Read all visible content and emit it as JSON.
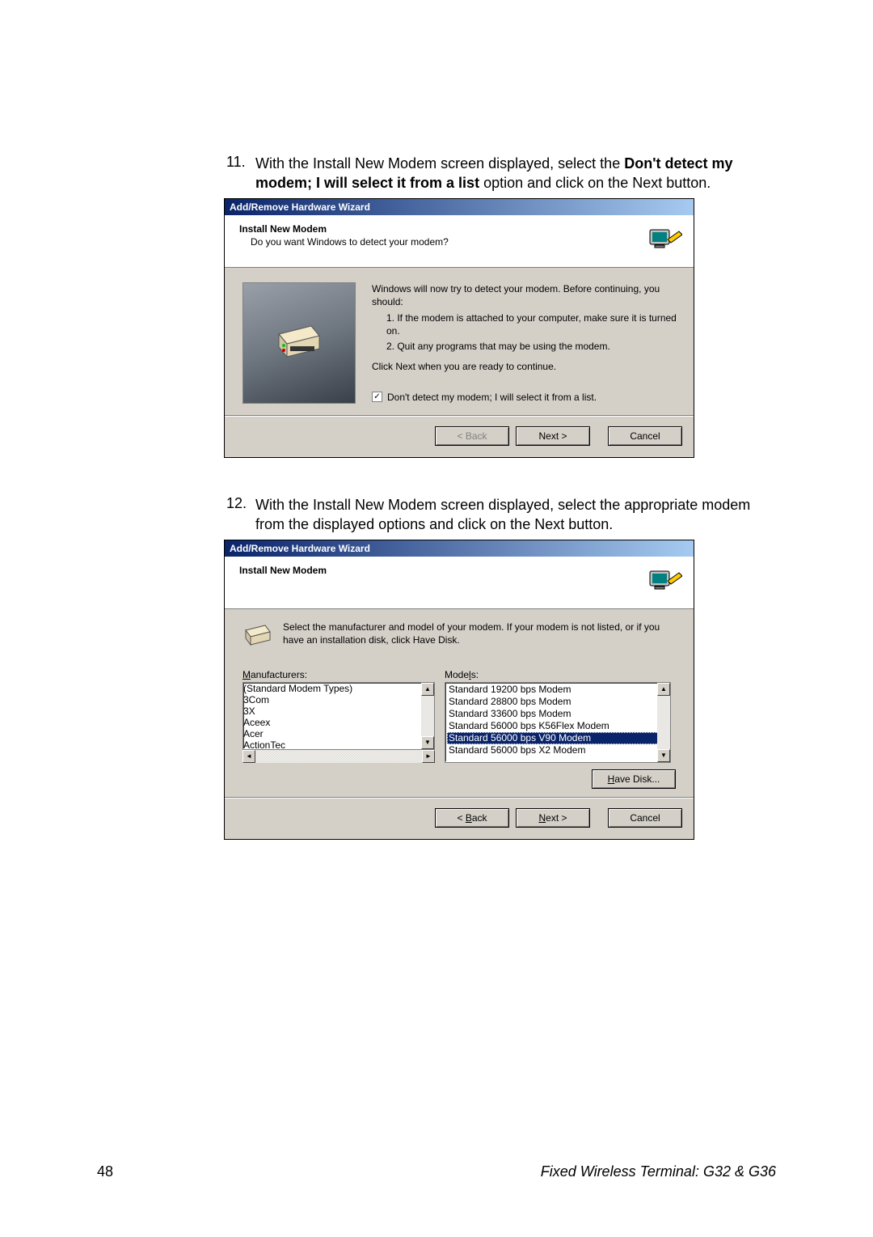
{
  "instructions": {
    "step11": {
      "num": "11.",
      "text_pre": "With the Install New Modem screen displayed, select the ",
      "bold1": "Don't detect my modem; I will select it from a list",
      "text_mid": " option and click on the Next button."
    },
    "step12": {
      "num": "12.",
      "text": "With the Install New Modem screen displayed, select the appropriate modem from the displayed options and click on the Next button."
    }
  },
  "dialog1": {
    "title": "Add/Remove Hardware Wizard",
    "header_title": "Install New Modem",
    "header_sub": "Do you want Windows to detect your modem?",
    "body_intro": "Windows will now try to detect your modem.  Before continuing, you should:",
    "body_item1": "1.  If the modem is attached to your computer, make sure it is turned on.",
    "body_item2": "2.  Quit any programs that may be using the modem.",
    "body_continue": "Click Next when you are ready to continue.",
    "checkbox_label": "Don't detect my modem; I will select it from a list.",
    "checkbox_checked": true,
    "btn_back": "< Back",
    "btn_next": "Next >",
    "btn_cancel": "Cancel"
  },
  "dialog2": {
    "title": "Add/Remove Hardware Wizard",
    "header_title": "Install New Modem",
    "select_text": "Select the manufacturer and model of your modem. If your modem is not listed, or if you have an installation disk, click Have Disk.",
    "manu_label": "Manufacturers:",
    "models_label": "Models:",
    "manufacturers": [
      "(Standard Modem Types)",
      "3Com",
      "3X",
      "Aceex",
      "Acer",
      "ActionTec"
    ],
    "manufacturers_selected_index": 0,
    "models": [
      "Standard 19200 bps Modem",
      "Standard 28800 bps Modem",
      "Standard 33600 bps Modem",
      "Standard 56000 bps K56Flex Modem",
      "Standard 56000 bps V90 Modem",
      "Standard 56000 bps X2 Modem"
    ],
    "models_selected_index": 4,
    "btn_have_disk": "Have Disk...",
    "btn_back": "< Back",
    "btn_next": "Next >",
    "btn_cancel": "Cancel"
  },
  "page": {
    "number": "48",
    "footer_right": "Fixed Wireless Terminal: G32 & G36"
  }
}
